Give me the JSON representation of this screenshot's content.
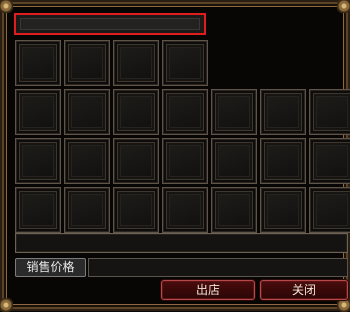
{
  "store_window": {
    "name_field": {
      "value": ""
    },
    "slot_rows": [
      {
        "row": 1,
        "count": 4
      },
      {
        "row": 2,
        "count": 7
      },
      {
        "row": 3,
        "count": 7
      },
      {
        "row": 4,
        "count": 7
      }
    ],
    "price_label": "销售价格",
    "price_value": "",
    "buttons": {
      "sell": "出店",
      "close": "关闭"
    },
    "colors": {
      "highlight_border": "#e11c1c",
      "button_fill": "#4a0c0c",
      "frame_gold": "#8a6a3e"
    }
  }
}
